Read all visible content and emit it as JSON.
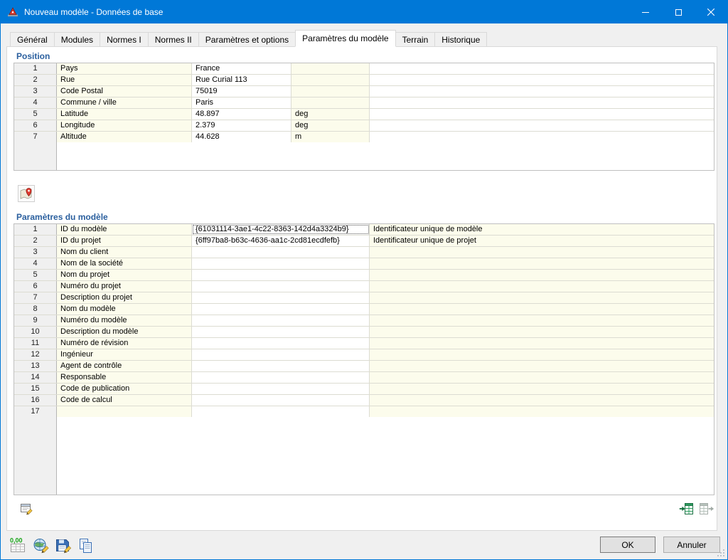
{
  "window": {
    "title": "Nouveau modèle - Données de base"
  },
  "tabs": [
    {
      "id": "general",
      "label": "Général",
      "active": false
    },
    {
      "id": "modules",
      "label": "Modules",
      "active": false
    },
    {
      "id": "normes-1",
      "label": "Normes I",
      "active": false
    },
    {
      "id": "normes-2",
      "label": "Normes II",
      "active": false
    },
    {
      "id": "parametres-et-options",
      "label": "Paramètres et options",
      "active": false
    },
    {
      "id": "parametres-du-modele",
      "label": "Paramètres du modèle",
      "active": true
    },
    {
      "id": "terrain",
      "label": "Terrain",
      "active": false
    },
    {
      "id": "historique",
      "label": "Historique",
      "active": false
    }
  ],
  "sections": {
    "position": {
      "title": "Position",
      "rows": [
        {
          "num": "1",
          "label": "Pays",
          "value": "France",
          "unit": ""
        },
        {
          "num": "2",
          "label": "Rue",
          "value": "Rue Curial 113",
          "unit": ""
        },
        {
          "num": "3",
          "label": "Code Postal",
          "value": "75019",
          "unit": ""
        },
        {
          "num": "4",
          "label": "Commune / ville",
          "value": "Paris",
          "unit": ""
        },
        {
          "num": "5",
          "label": "Latitude",
          "value": "48.897",
          "unit": "deg"
        },
        {
          "num": "6",
          "label": "Longitude",
          "value": "2.379",
          "unit": "deg"
        },
        {
          "num": "7",
          "label": "Altitude",
          "value": "44.628",
          "unit": "m"
        }
      ]
    },
    "model": {
      "title": "Paramètres du modèle",
      "rows": [
        {
          "num": "1",
          "label": "ID du modèle",
          "value": "{61031114-3ae1-4c22-8363-142d4a3324b9}",
          "desc": "Identificateur unique de modèle"
        },
        {
          "num": "2",
          "label": "ID du projet",
          "value": "{6ff97ba8-b63c-4636-aa1c-2cd81ecdfefb}",
          "desc": "Identificateur unique de projet"
        },
        {
          "num": "3",
          "label": "Nom du client",
          "value": "",
          "desc": ""
        },
        {
          "num": "4",
          "label": "Nom de la société",
          "value": "",
          "desc": ""
        },
        {
          "num": "5",
          "label": "Nom du projet",
          "value": "",
          "desc": ""
        },
        {
          "num": "6",
          "label": "Numéro du projet",
          "value": "",
          "desc": ""
        },
        {
          "num": "7",
          "label": "Description du projet",
          "value": "",
          "desc": ""
        },
        {
          "num": "8",
          "label": "Nom du modèle",
          "value": "",
          "desc": ""
        },
        {
          "num": "9",
          "label": "Numéro du modèle",
          "value": "",
          "desc": ""
        },
        {
          "num": "10",
          "label": "Description du modèle",
          "value": "",
          "desc": ""
        },
        {
          "num": "11",
          "label": "Numéro de révision",
          "value": "",
          "desc": ""
        },
        {
          "num": "12",
          "label": "Ingénieur",
          "value": "",
          "desc": ""
        },
        {
          "num": "13",
          "label": "Agent de contrôle",
          "value": "",
          "desc": ""
        },
        {
          "num": "14",
          "label": "Responsable",
          "value": "",
          "desc": ""
        },
        {
          "num": "15",
          "label": "Code de publication",
          "value": "",
          "desc": ""
        },
        {
          "num": "16",
          "label": "Code de calcul",
          "value": "",
          "desc": ""
        },
        {
          "num": "17",
          "label": "",
          "value": "",
          "desc": ""
        }
      ]
    }
  },
  "toolbar": {
    "units_label": "0,00"
  },
  "footer": {
    "ok_label": "OK",
    "cancel_label": "Annuler"
  },
  "icons": {
    "app-icon": "▲",
    "minimize-icon": "—",
    "maximize-icon": "▢",
    "close-icon": "✕",
    "map-pin-icon": "📍",
    "comment-icon": "✎",
    "excel-import-icon": "▦→",
    "excel-export-icon": "→▦",
    "decimal-places-icon": "0,00",
    "globe-edit-icon": "🌐✎",
    "save-edit-icon": "💾✎",
    "copy-icon": "⧉",
    "resize-grip-icon": "⋱"
  }
}
